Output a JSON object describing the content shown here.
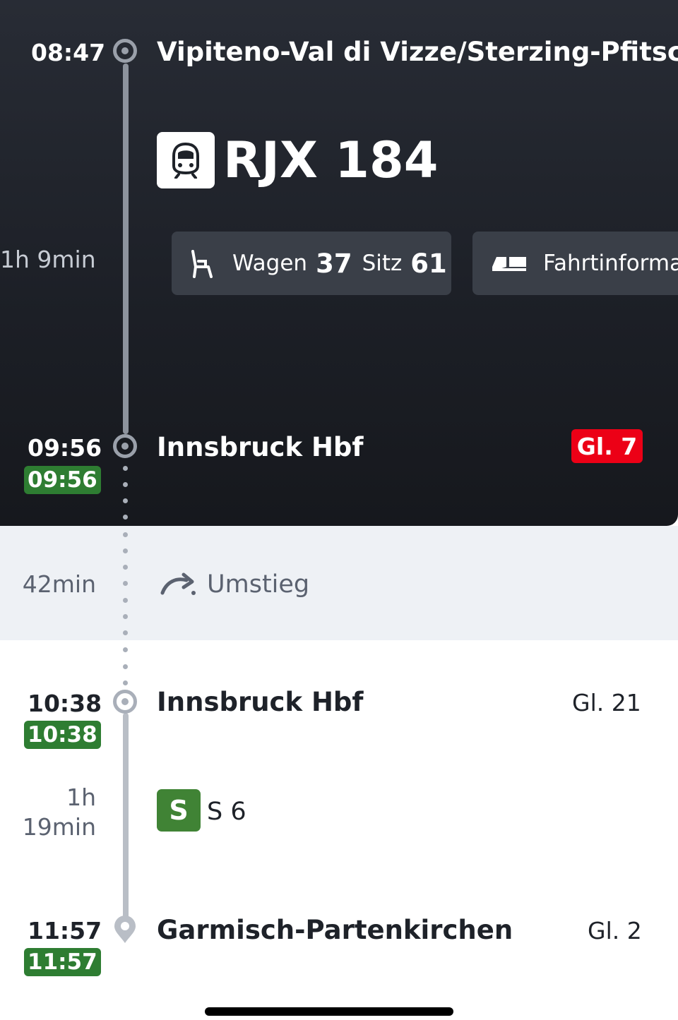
{
  "leg1": {
    "departure": {
      "time": "08:47",
      "station": "Vipiteno-Val di Vizze/Sterzing-Pfitsch"
    },
    "duration": "1h 9min",
    "train": {
      "icon": "train-front-icon",
      "name": "RJX 184"
    },
    "seat": {
      "icon": "seat-icon",
      "wagen_label": "Wagen",
      "wagen_value": "37",
      "sitz_label": "Sitz",
      "sitz_value": "61"
    },
    "info": {
      "icon": "train-info-icon",
      "label": "Fahrtinformat"
    },
    "arrival": {
      "time": "09:56",
      "realtime": "09:56",
      "station": "Innsbruck Hbf",
      "track": "Gl. 7",
      "track_color": "#ec0016"
    }
  },
  "transfer": {
    "duration": "42min",
    "icon": "transfer-arrow-icon",
    "label": "Umstieg"
  },
  "leg2": {
    "departure": {
      "time": "10:38",
      "realtime": "10:38",
      "station": "Innsbruck Hbf",
      "track": "Gl. 21"
    },
    "duration_h": "1h",
    "duration_m": "19min",
    "train": {
      "badge": "S",
      "name": "S 6",
      "badge_color": "#408335"
    },
    "arrival": {
      "time": "11:57",
      "realtime": "11:57",
      "station": "Garmisch-Partenkirchen",
      "track": "Gl. 2"
    }
  },
  "colors": {
    "realtime_green": "#2e7d32",
    "dark_card": "#1f232a",
    "transfer_band": "#eef1f5"
  }
}
